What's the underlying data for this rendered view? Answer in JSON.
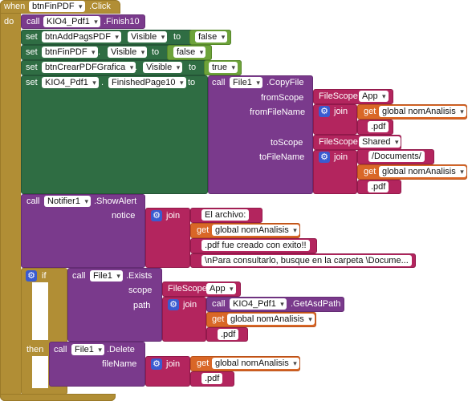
{
  "event": {
    "when": "when",
    "component": "btnFinPDF",
    "event": ".Click",
    "do": "do"
  },
  "finish": {
    "call": "call",
    "component": "KIO4_Pdf1",
    "method": ".Finish10"
  },
  "set1": {
    "set": "set",
    "component": "btnAddPagsPDF",
    "dot": ".",
    "prop": "Visible",
    "to": "to",
    "value": "false"
  },
  "set2": {
    "set": "set",
    "component": "btnFinPDF",
    "dot": ".",
    "prop": "Visible",
    "to": "to",
    "value": "false"
  },
  "set3": {
    "set": "set",
    "component": "btnCrearPDFGrafica",
    "dot": ".",
    "prop": "Visible",
    "to": "to",
    "value": "true"
  },
  "set4": {
    "set": "set",
    "component": "KIO4_Pdf1",
    "dot": ".",
    "prop": "FinishedPage10",
    "to": "to"
  },
  "copy": {
    "call": "call",
    "component": "File1",
    "method": ".CopyFile",
    "fromScope": "fromScope",
    "fromFileName": "fromFileName",
    "toScope": "toScope",
    "toFileName": "toFileName",
    "fileScope1": "FileScope",
    "scope1": "App",
    "join": "join",
    "get": "get",
    "var": "global nomAnalisis",
    "pdf": ".pdf",
    "fileScope2": "FileScope",
    "scope2": "Shared",
    "documents": "/Documents/"
  },
  "alert": {
    "call": "call",
    "component": "Notifier1",
    "method": ".ShowAlert",
    "notice": "notice",
    "join": "join",
    "t1": "El archivo:",
    "get": "get",
    "var": "global nomAnalisis",
    "t2": ".pdf fue creado con exito!!",
    "t3": "\\nPara consultarlo, busque en la carpeta \\Docume..."
  },
  "ifblk": {
    "if": "if",
    "then": "then",
    "call": "call",
    "component": "File1",
    "method": ".Exists",
    "scope": "scope",
    "path": "path",
    "fileScope": "FileScope",
    "scopeVal": "App",
    "join": "join",
    "call2": "call",
    "component2": "KIO4_Pdf1",
    "method2": ".GetAsdPath",
    "get": "get",
    "var": "global nomAnalisis",
    "pdf": ".pdf"
  },
  "del": {
    "call": "call",
    "component": "File1",
    "method": ".Delete",
    "fileName": "fileName",
    "join": "join",
    "get": "get",
    "var": "global nomAnalisis",
    "pdf": ".pdf"
  },
  "colors": {
    "event": "#b18e35",
    "component": "#7a3a8c",
    "setter": "#2f6d43",
    "text": "#b3255e",
    "variable": "#d96727",
    "logic": "#6da33a",
    "mutator": "#3a5bd0"
  }
}
